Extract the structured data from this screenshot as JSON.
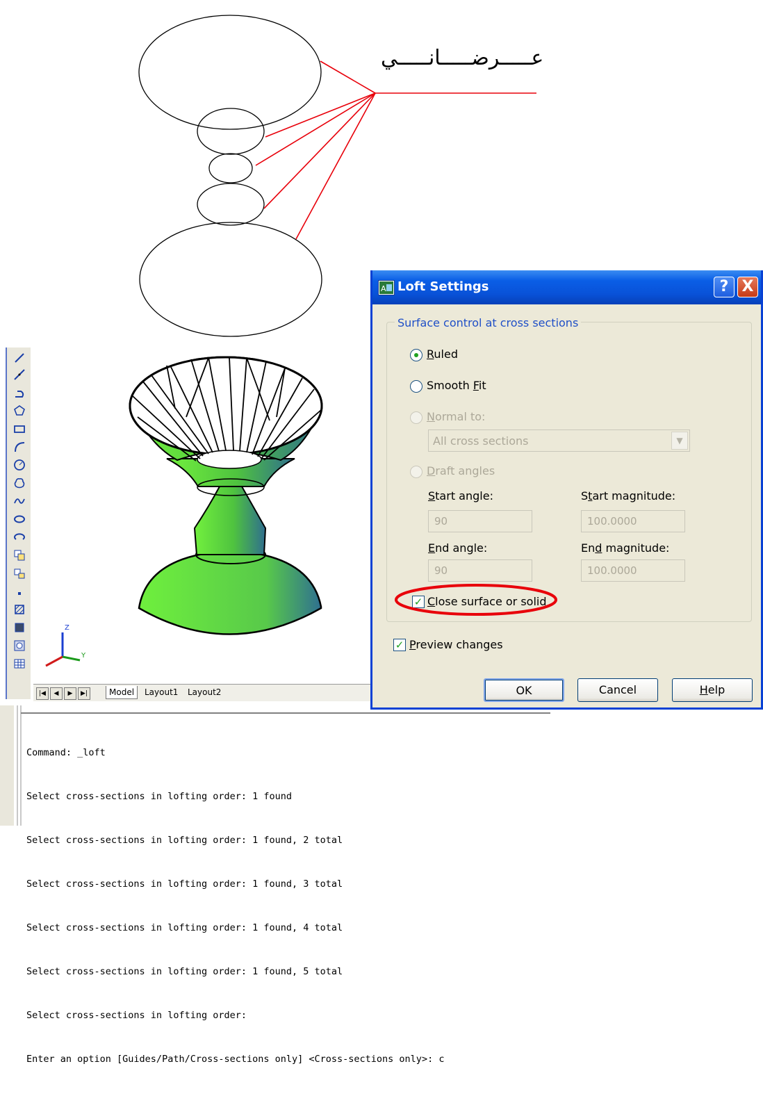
{
  "annotation": {
    "label": "عـــــرضـــــانـــــي"
  },
  "toolbar": {
    "icons": [
      "line-icon",
      "construction-line-icon",
      "polyline-icon",
      "polygon-icon",
      "rectangle-icon",
      "arc-icon",
      "circle-icon",
      "revision-cloud-icon",
      "spline-icon",
      "ellipse-icon",
      "ellipse-arc-icon",
      "insert-block-icon",
      "make-block-icon",
      "point-icon",
      "hatch-icon",
      "gradient-icon",
      "region-icon",
      "table-icon"
    ]
  },
  "axes": {
    "z": "Z",
    "y": "Y"
  },
  "tabs": {
    "model": "Model",
    "layout1": "Layout1",
    "layout2": "Layout2"
  },
  "command": {
    "lines": [
      "Command: _loft",
      "Select cross-sections in lofting order: 1 found",
      "Select cross-sections in lofting order: 1 found, 2 total",
      "Select cross-sections in lofting order: 1 found, 3 total",
      "Select cross-sections in lofting order: 1 found, 4 total",
      "Select cross-sections in lofting order: 1 found, 5 total",
      "Select cross-sections in lofting order:",
      "Enter an option [Guides/Path/Cross-sections only] <Cross-sections only>: c"
    ]
  },
  "dialog": {
    "title": "Loft Settings",
    "help_button": "?",
    "close_button": "X",
    "group_label": "Surface control at cross sections",
    "ruled": {
      "first": "R",
      "rest": "uled",
      "selected": true
    },
    "smooth_fit": {
      "pre": "Smooth ",
      "ul": "F",
      "post": "it",
      "selected": false
    },
    "normal_to": {
      "ul": "N",
      "rest": "ormal to:",
      "enabled": false
    },
    "normal_to_value": "All cross sections",
    "draft_angles": {
      "ul": "D",
      "rest": "raft angles",
      "enabled": false
    },
    "start_angle": {
      "ul": "S",
      "rest": "tart angle:",
      "value": "90"
    },
    "start_magnitude": {
      "pre": "S",
      "ul": "t",
      "rest": "art magnitude:",
      "value": "100.0000"
    },
    "end_angle": {
      "ul": "E",
      "rest": "nd angle:",
      "value": "90"
    },
    "end_magnitude": {
      "pre": "En",
      "ul": "d",
      "rest": " magnitude:",
      "value": "100.0000"
    },
    "close_surface": {
      "ul": "C",
      "rest": "lose surface or solid",
      "checked": true
    },
    "preview_changes": {
      "ul": "P",
      "rest": "review changes",
      "checked": true
    },
    "ok": "OK",
    "cancel": "Cancel",
    "help": {
      "ul": "H",
      "rest": "elp"
    }
  },
  "colors": {
    "annotation_lines": "#e8000a",
    "highlight_ellipse": "#e8000a",
    "titlebar": "#0a5ee6",
    "solid_green": "#62ea3a",
    "solid_blue": "#2f6e8e"
  }
}
